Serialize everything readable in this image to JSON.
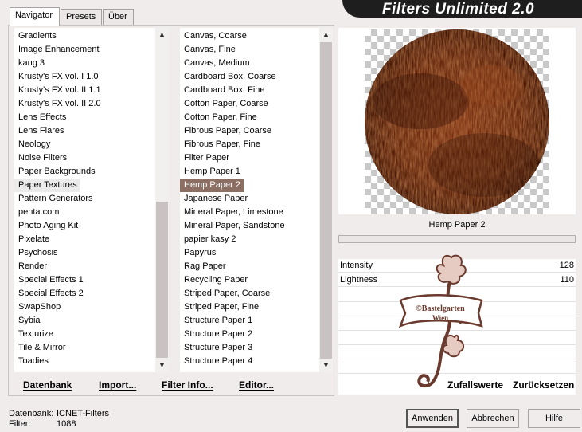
{
  "app": {
    "title": "Filters Unlimited 2.0"
  },
  "tabs": [
    {
      "label": "Navigator"
    },
    {
      "label": "Presets"
    },
    {
      "label": "Über"
    }
  ],
  "categories": {
    "items": [
      "Gradients",
      "Image Enhancement",
      "kang 3",
      "Krusty's FX vol. I 1.0",
      "Krusty's FX vol. II 1.1",
      "Krusty's FX vol. II 2.0",
      "Lens Effects",
      "Lens Flares",
      "Neology",
      "Noise Filters",
      "Paper Backgrounds",
      "Paper Textures",
      "Pattern Generators",
      "penta.com",
      "Photo Aging Kit",
      "Pixelate",
      "Psychosis",
      "Render",
      "Special Effects 1",
      "Special Effects 2",
      "SwapShop",
      "Sybia",
      "Texturize",
      "Tile & Mirror",
      "Toadies"
    ],
    "selected": "Paper Textures"
  },
  "filters": {
    "items": [
      "Canvas, Coarse",
      "Canvas, Fine",
      "Canvas, Medium",
      "Cardboard Box, Coarse",
      "Cardboard Box, Fine",
      "Cotton Paper, Coarse",
      "Cotton Paper, Fine",
      "Fibrous Paper, Coarse",
      "Fibrous Paper, Fine",
      "Filter Paper",
      "Hemp Paper 1",
      "Hemp Paper 2",
      "Japanese Paper",
      "Mineral Paper, Limestone",
      "Mineral Paper, Sandstone",
      "papier kasy 2",
      "Papyrus",
      "Rag Paper",
      "Recycling Paper",
      "Striped Paper, Coarse",
      "Striped Paper, Fine",
      "Structure Paper 1",
      "Structure Paper 2",
      "Structure Paper 3",
      "Structure Paper 4"
    ],
    "selected": "Hemp Paper 2"
  },
  "list_buttons": {
    "datenbank": "Datenbank",
    "import": "Import...",
    "filter_info": "Filter Info...",
    "editor": "Editor..."
  },
  "preview": {
    "filter_name": "Hemp Paper 2",
    "progress": 0
  },
  "params": [
    {
      "label": "Intensity",
      "value": "128"
    },
    {
      "label": "Lightness",
      "value": "110"
    }
  ],
  "watermark": {
    "text1": "©Bastelgarten",
    "text2": "Wien"
  },
  "param_buttons": {
    "random": "Zufallswerte",
    "reset": "Zurücksetzen"
  },
  "footer": {
    "db_label": "Datenbank:",
    "db_value": "ICNET-Filters",
    "filter_label": "Filter:",
    "filter_value": "1088"
  },
  "dialog_buttons": {
    "apply": "Anwenden",
    "cancel": "Abbrechen",
    "help": "Hilfe"
  },
  "colors": {
    "accent": "#8d6e63",
    "texture_dark": "#4a1c08",
    "texture_mid": "#8a3a16",
    "watermark": "#6b3a2e"
  }
}
